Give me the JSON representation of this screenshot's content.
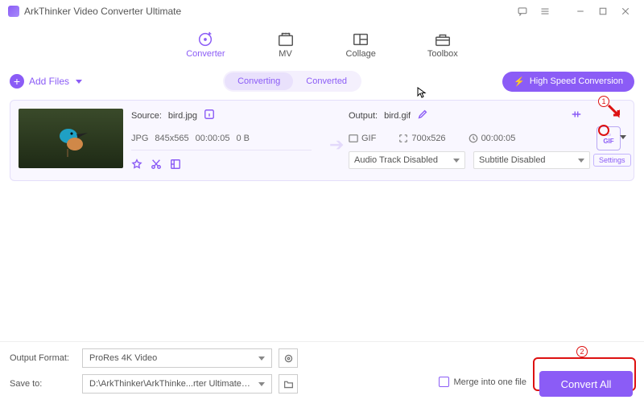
{
  "app_title": "ArkThinker Video Converter Ultimate",
  "tabs": {
    "converter": "Converter",
    "mv": "MV",
    "collage": "Collage",
    "toolbox": "Toolbox"
  },
  "toolbar": {
    "add_files": "Add Files",
    "converting": "Converting",
    "converted": "Converted",
    "high_speed": "High Speed Conversion"
  },
  "file": {
    "source_label": "Source:",
    "source_name": "bird.jpg",
    "format_in": "JPG",
    "resolution_in": "845x565",
    "duration_in": "00:00:05",
    "size_in": "0 B",
    "output_label": "Output:",
    "output_name": "bird.gif",
    "format_out": "GIF",
    "resolution_out": "700x526",
    "duration_out": "00:00:05",
    "audio_select": "Audio Track Disabled",
    "subtitle_select": "Subtitle Disabled",
    "fmt_tile_top": "▭",
    "fmt_tile_label": "GIF",
    "settings": "Settings"
  },
  "bottom": {
    "output_format_label": "Output Format:",
    "output_format_value": "ProRes 4K Video",
    "save_to_label": "Save to:",
    "save_to_value": "D:\\ArkThinker\\ArkThinke...rter Ultimate\\Converted",
    "merge": "Merge into one file",
    "convert": "Convert All"
  },
  "annotations": {
    "num1": "1",
    "num2": "2"
  }
}
